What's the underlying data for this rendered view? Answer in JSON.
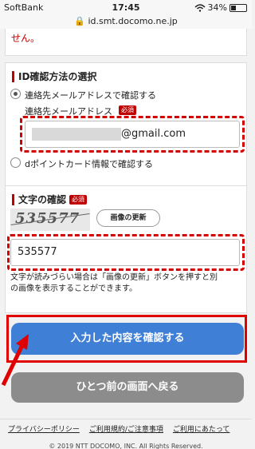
{
  "status": {
    "carrier": "SoftBank",
    "time": "17:45",
    "battery": "34%",
    "battery_level": 0.34
  },
  "url": "id.smt.docomo.ne.jp",
  "top_note": "せん。",
  "id_section": {
    "title": "ID確認方法の選択",
    "option_email": "連絡先メールアドレスで確認する",
    "email_label": "連絡先メールアドレス",
    "required": "必須",
    "email_value": "@gmail.com",
    "option_dpoint": "dポイントカード情報で確認する"
  },
  "captcha_section": {
    "title": "文字の確認",
    "required": "必須",
    "captcha_image_text": "535577",
    "refresh_label": "画像の更新",
    "input_value": "535577",
    "help_line1": "文字が読みづらい場合は「画像の更新」ボタンを押すと別",
    "help_line2": "の画像を表示することができます。"
  },
  "buttons": {
    "confirm": "入力した内容を確認する",
    "back": "ひとつ前の画面へ戻る"
  },
  "footer": {
    "links": [
      "プライバシーポリシー",
      "ご利用規約/ご注意事項",
      "ご利用にあたって"
    ],
    "copyright": "© 2019 NTT DOCOMO, INC. All Rights Reserved."
  }
}
